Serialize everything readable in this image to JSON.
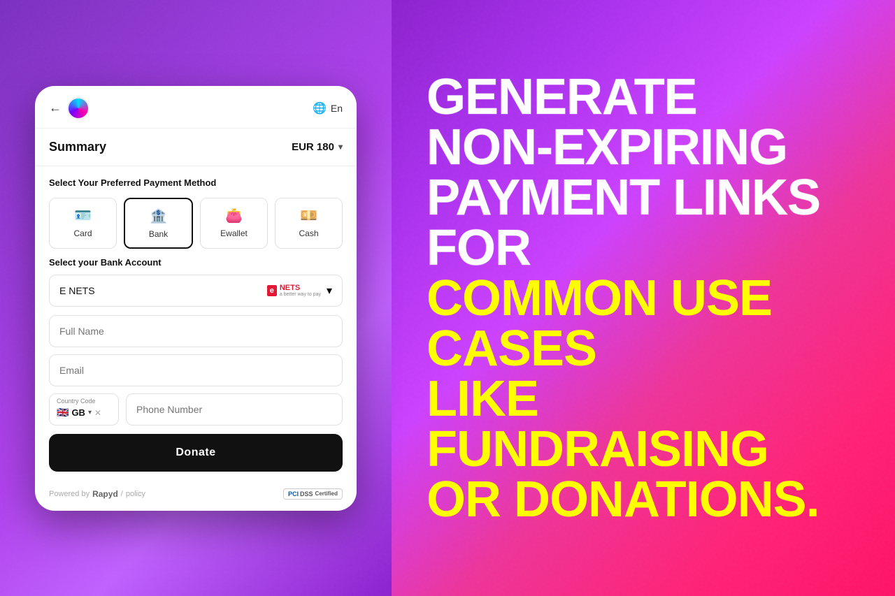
{
  "header": {
    "back_label": "←",
    "language_label": "En",
    "globe_icon": "🌐"
  },
  "summary": {
    "title": "Summary",
    "amount": "EUR 180",
    "chevron": "▾"
  },
  "payment_method_section": {
    "title": "Select Your Preferred Payment Method",
    "methods": [
      {
        "id": "card",
        "label": "Card",
        "icon": "💳"
      },
      {
        "id": "bank",
        "label": "Bank",
        "icon": "🏦",
        "active": true
      },
      {
        "id": "ewallet",
        "label": "Ewallet",
        "icon": "👜"
      },
      {
        "id": "cash",
        "label": "Cash",
        "icon": "💵"
      }
    ]
  },
  "bank_account": {
    "title": "Select your Bank Account",
    "selected": "E NETS",
    "logo_e": "e",
    "logo_nets": "NETS",
    "logo_tagline": "a better way to pay",
    "chevron": "▾"
  },
  "form": {
    "full_name_placeholder": "Full Name",
    "email_placeholder": "Email",
    "country_code_label": "Country Code",
    "country_flag": "🇬🇧",
    "country_code": "GB",
    "phone_placeholder": "Phone Number"
  },
  "donate_button": {
    "label": "Donate"
  },
  "footer": {
    "powered_by": "Powered by",
    "brand": "Rapyd",
    "separator": "/",
    "policy": "policy",
    "pci_label": "PCI",
    "dss_label": "DSS",
    "certified": "Certified"
  },
  "marketing": {
    "line1": "GENERATE",
    "line2": "NON-EXPIRING",
    "line3": "PAYMENT LINKS FOR",
    "line4": "COMMON USE CASES",
    "line5": "LIKE FUNDRAISING",
    "line6": "OR DONATIONS."
  }
}
